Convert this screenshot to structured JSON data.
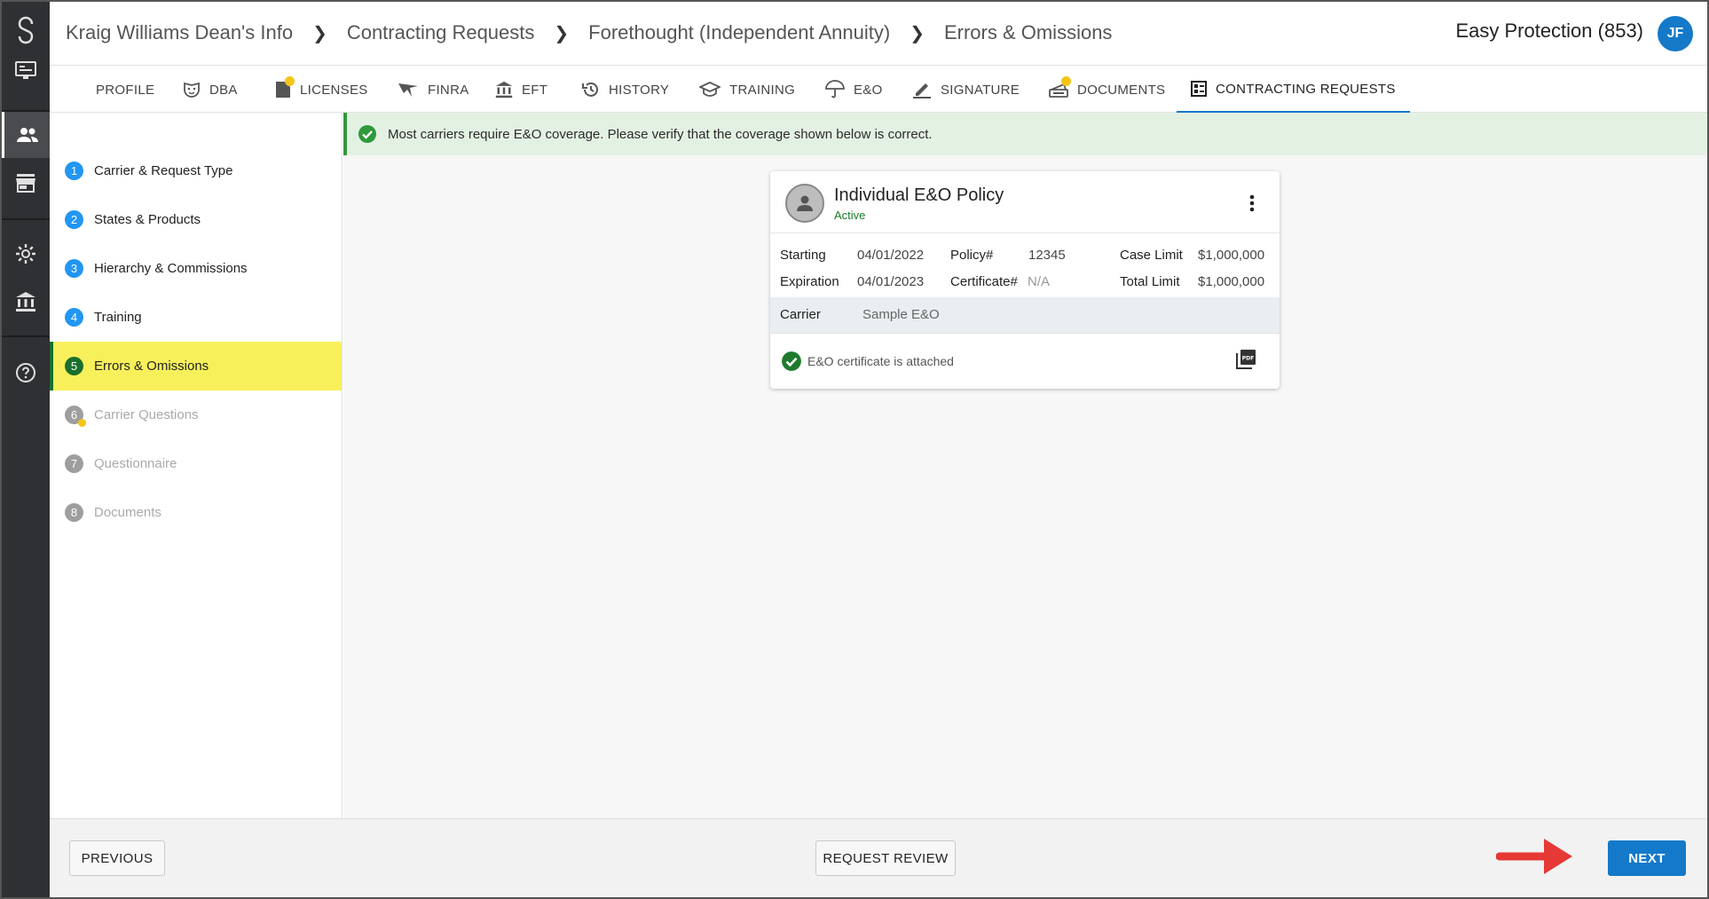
{
  "breadcrumb": [
    "Kraig Williams Dean's Info",
    "Contracting Requests",
    "Forethought (Independent Annuity)",
    "Errors & Omissions"
  ],
  "agency": "Easy Protection (853)",
  "user_initials": "JF",
  "tabs": {
    "profile": "PROFILE",
    "dba": "DBA",
    "licenses": "LICENSES",
    "finra": "FINRA",
    "eft": "EFT",
    "history": "HISTORY",
    "training": "TRAINING",
    "eo": "E&O",
    "signature": "SIGNATURE",
    "documents": "DOCUMENTS",
    "contracting": "CONTRACTING REQUESTS"
  },
  "steps": [
    {
      "num": "1",
      "label": "Carrier & Request Type"
    },
    {
      "num": "2",
      "label": "States & Products"
    },
    {
      "num": "3",
      "label": "Hierarchy & Commissions"
    },
    {
      "num": "4",
      "label": "Training"
    },
    {
      "num": "5",
      "label": "Errors & Omissions"
    },
    {
      "num": "6",
      "label": "Carrier Questions"
    },
    {
      "num": "7",
      "label": "Questionnaire"
    },
    {
      "num": "8",
      "label": "Documents"
    }
  ],
  "alert": "Most carriers require E&O coverage. Please verify that the coverage shown below is correct.",
  "policy": {
    "title": "Individual E&O Policy",
    "status": "Active",
    "starting_label": "Starting",
    "starting": "04/01/2022",
    "expiration_label": "Expiration",
    "expiration": "04/01/2023",
    "policy_label": "Policy#",
    "policy_no": "12345",
    "certificate_label": "Certificate#",
    "certificate": "N/A",
    "case_limit_label": "Case Limit",
    "case_limit": "$1,000,000",
    "total_limit_label": "Total Limit",
    "total_limit": "$1,000,000",
    "carrier_label": "Carrier",
    "carrier": "Sample E&O",
    "cert_text": "E&O certificate is attached"
  },
  "buttons": {
    "previous": "PREVIOUS",
    "request_review": "REQUEST REVIEW",
    "next": "NEXT"
  },
  "colors": {
    "accent": "#1479c9",
    "active_step": "#f8f05a",
    "success": "#2e9a3c",
    "arrow": "#e53935"
  }
}
